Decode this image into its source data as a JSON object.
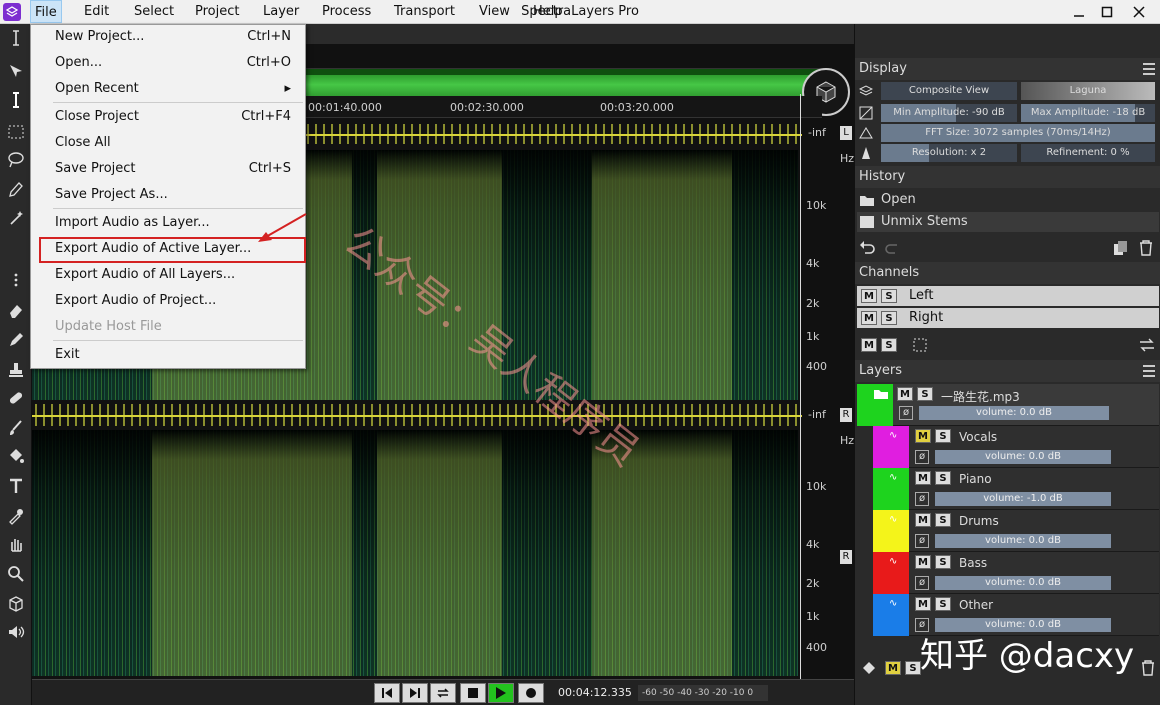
{
  "window": {
    "title": "SpectraLayers Pro"
  },
  "menubar": {
    "items": [
      "File",
      "Edit",
      "Select",
      "Project",
      "Layer",
      "Process",
      "Transport",
      "View",
      "Help"
    ]
  },
  "file_menu": {
    "items": [
      {
        "label": "New Project...",
        "shortcut": "Ctrl+N"
      },
      {
        "label": "Open...",
        "shortcut": "Ctrl+O"
      },
      {
        "label": "Open Recent",
        "shortcut": ""
      },
      {
        "label": "Close Project",
        "shortcut": "Ctrl+F4"
      },
      {
        "label": "Close All",
        "shortcut": ""
      },
      {
        "label": "Save Project",
        "shortcut": "Ctrl+S"
      },
      {
        "label": "Save Project As...",
        "shortcut": ""
      },
      {
        "label": "Import Audio as Layer...",
        "shortcut": ""
      },
      {
        "label": "Export Audio of Active Layer...",
        "shortcut": ""
      },
      {
        "label": "Export Audio of All Layers...",
        "shortcut": ""
      },
      {
        "label": "Export Audio of Project...",
        "shortcut": ""
      },
      {
        "label": "Update Host File",
        "shortcut": ""
      },
      {
        "label": "Exit",
        "shortcut": ""
      }
    ]
  },
  "timeline": {
    "ticks": [
      "00:01:40.000",
      "00:02:30.000",
      "00:03:20.000"
    ]
  },
  "waveform": {
    "peak_label": "-inf",
    "channels": [
      "L",
      "R"
    ]
  },
  "spectrogram": {
    "unit": "Hz",
    "freq_labels": [
      "10k",
      "4k",
      "2k",
      "1k",
      "400"
    ]
  },
  "transport": {
    "timecode": "00:04:12.335",
    "meter_scale": "-60 -50 -40 -30 -20 -10  0"
  },
  "display": {
    "title": "Display",
    "view_mode": "Composite View",
    "palette": "Laguna",
    "min_amplitude": "Min Amplitude: -90 dB",
    "min_amplitude_level": 0.55,
    "max_amplitude": "Max Amplitude: -18 dB",
    "max_amplitude_level": 0.85,
    "fft_size": "FFT Size: 3072  samples (70ms/14Hz)",
    "resolution": "Resolution: x 2",
    "resolution_level": 0.35,
    "refinement": "Refinement: 0 %"
  },
  "history": {
    "title": "History",
    "items": [
      "Open",
      "Unmix Stems"
    ]
  },
  "channels": {
    "title": "Channels",
    "items": [
      "Left",
      "Right"
    ],
    "m": "M",
    "s": "S"
  },
  "layers": {
    "title": "Layers",
    "parent": {
      "name": "一路生花.mp3",
      "volume": "volume: 0.0 dB",
      "color": "#1ed31e"
    },
    "items": [
      {
        "name": "Vocals",
        "volume": "volume: 0.0 dB",
        "color": "#e01ee0"
      },
      {
        "name": "Piano",
        "volume": "volume: -1.0 dB",
        "color": "#1ed31e"
      },
      {
        "name": "Drums",
        "volume": "volume: 0.0 dB",
        "color": "#f4f41a"
      },
      {
        "name": "Bass",
        "volume": "volume: 0.0 dB",
        "color": "#e81a1a"
      },
      {
        "name": "Other",
        "volume": "volume: 0.0 dB",
        "color": "#1a7de8"
      }
    ]
  },
  "watermark": {
    "text": "公众号：吴人程序员",
    "brand": "知乎 @dacxy"
  },
  "colors": {
    "accent_highlight": "#d42222",
    "menu_bg": "#f2f2f2"
  }
}
